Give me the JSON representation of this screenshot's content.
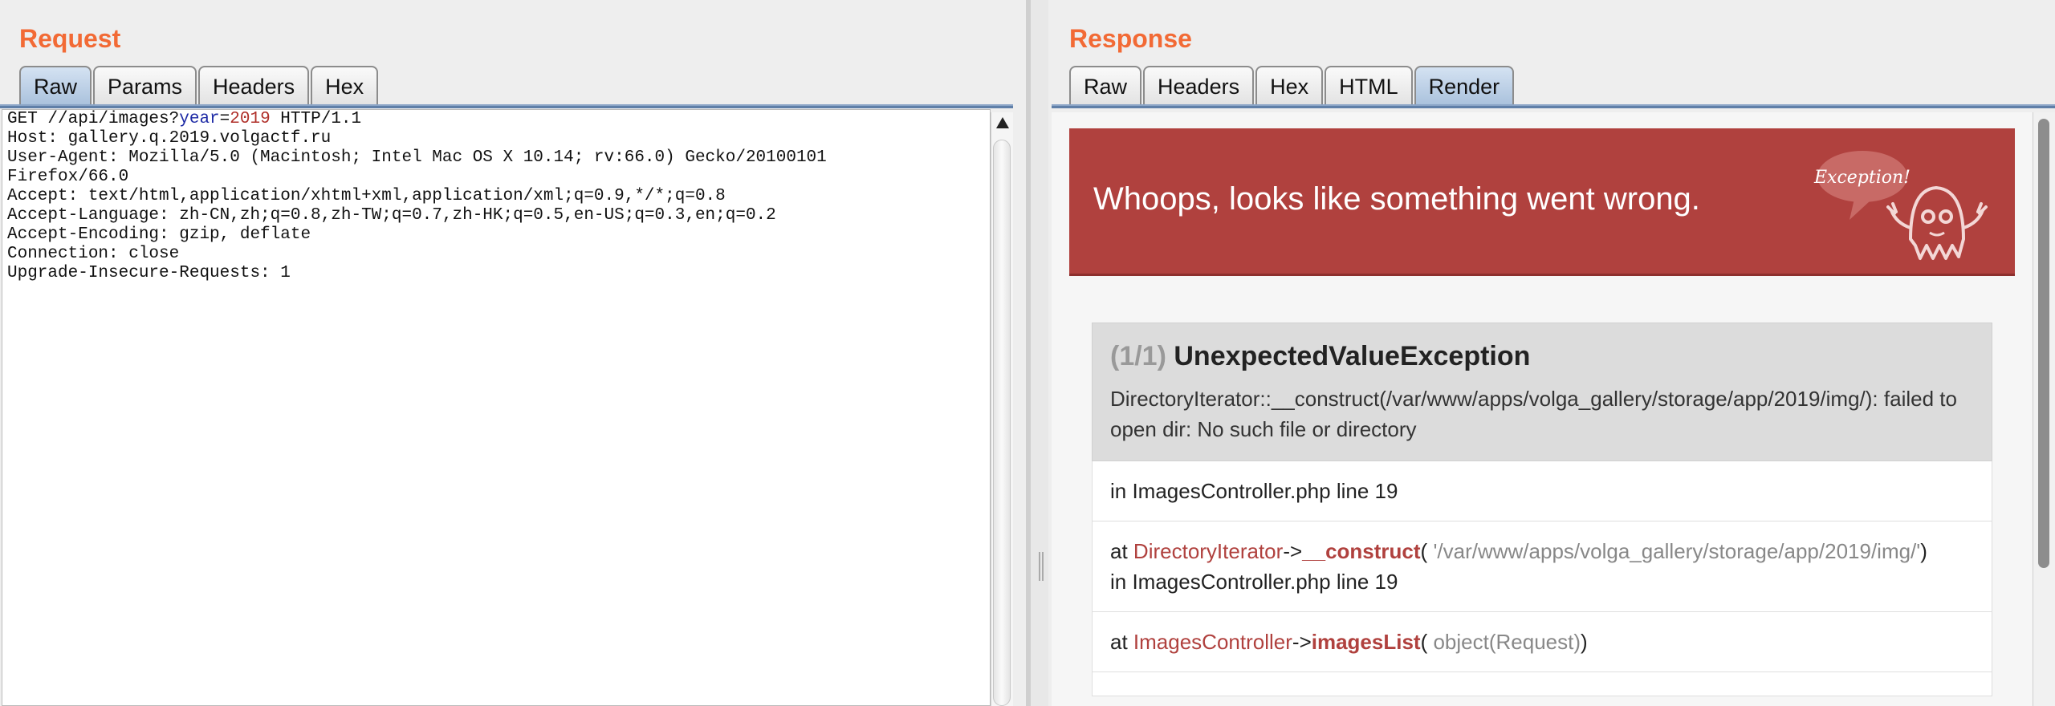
{
  "request": {
    "title": "Request",
    "tabs": [
      "Raw",
      "Params",
      "Headers",
      "Hex"
    ],
    "active_tab": "Raw",
    "request_line": {
      "method_path": "GET //api/images?",
      "param_name": "year",
      "equals": "=",
      "param_value": "2019",
      "protocol": " HTTP/1.1"
    },
    "header_lines": [
      "Host: gallery.q.2019.volgactf.ru",
      "User-Agent: Mozilla/5.0 (Macintosh; Intel Mac OS X 10.14; rv:66.0) Gecko/20100101",
      "Firefox/66.0",
      "Accept: text/html,application/xhtml+xml,application/xml;q=0.9,*/*;q=0.8",
      "Accept-Language: zh-CN,zh;q=0.8,zh-TW;q=0.7,zh-HK;q=0.5,en-US;q=0.3,en;q=0.2",
      "Accept-Encoding: gzip, deflate",
      "Connection: close",
      "Upgrade-Insecure-Requests: 1"
    ]
  },
  "response": {
    "title": "Response",
    "tabs": [
      "Raw",
      "Headers",
      "Hex",
      "HTML",
      "Render"
    ],
    "active_tab": "Render",
    "render": {
      "banner_text": "Whoops, looks like something went wrong.",
      "banner_badge": "Exception!",
      "exception": {
        "count": "(1/1)",
        "name": "UnexpectedValueException",
        "message": "DirectoryIterator::__construct(/var/www/apps/volga_gallery/storage/app/2019/img/): failed to open dir: No such file or directory"
      },
      "frames": [
        {
          "location": "in ImagesController.php line 19"
        },
        {
          "at": "at ",
          "class": "DirectoryIterator",
          "arrow": "->",
          "function": "__construct",
          "args": "'/var/www/apps/volga_gallery/storage/app/2019/img/'",
          "location": "in ImagesController.php line 19"
        },
        {
          "at": "at ",
          "class": "ImagesController",
          "arrow": "->",
          "function": "imagesList",
          "args": "object(Request)"
        }
      ]
    }
  },
  "colors": {
    "pane_title": "#f26a35",
    "banner": "#b0413e",
    "active_tab": "#a9c1dc"
  }
}
